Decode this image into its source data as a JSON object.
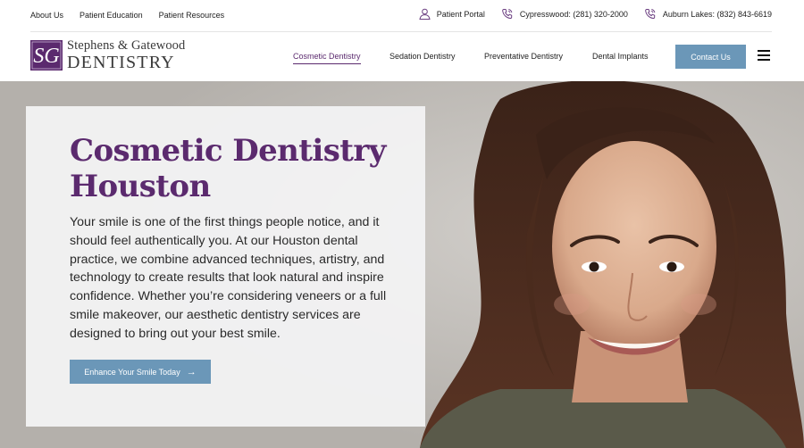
{
  "utility": {
    "links": [
      "About Us",
      "Patient Education",
      "Patient Resources"
    ],
    "portal_label": "Patient Portal",
    "phones": [
      {
        "label": "Cypresswood: (281) 320-2000"
      },
      {
        "label": "Auburn Lakes: (832) 843-6619"
      }
    ]
  },
  "logo": {
    "line1": "Stephens & Gatewood",
    "line2": "DENTISTRY",
    "monogram": "SG"
  },
  "nav": {
    "items": [
      {
        "label": "Cosmetic Dentistry",
        "active": true
      },
      {
        "label": "Sedation Dentistry",
        "active": false
      },
      {
        "label": "Preventative Dentistry",
        "active": false
      },
      {
        "label": "Dental Implants",
        "active": false
      }
    ],
    "contact_label": "Contact Us",
    "menu_icon": "hamburger-icon"
  },
  "hero": {
    "title_line1": "Cosmetic Dentistry",
    "title_line2": "Houston",
    "body": "Your smile is one of the first things people notice, and it should feel authentically you. At our Houston dental practice, we combine advanced techniques, artistry, and technology to create results that look natural and inspire confidence. Whether you’re considering veneers or a full smile makeover, our aesthetic dentistry services are designed to bring out your best smile.",
    "cta_label": "Enhance Your Smile Today",
    "cta_icon": "arrow-right-icon"
  },
  "colors": {
    "brand_purple": "#5b2a6e",
    "button_blue": "#6b97b8"
  }
}
